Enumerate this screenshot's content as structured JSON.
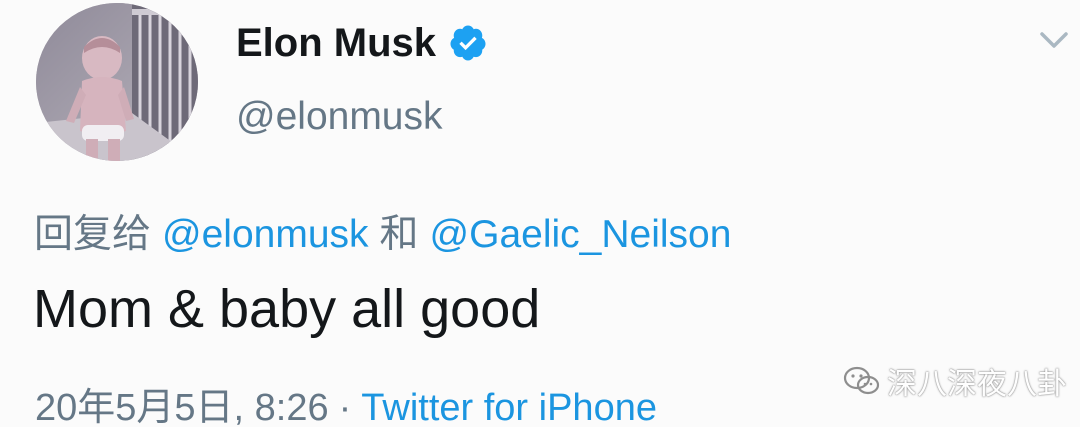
{
  "author": {
    "display_name": "Elon Musk",
    "handle": "@elonmusk",
    "verified": true,
    "avatar_icon": "toddler-photo-avatar"
  },
  "reply": {
    "prefix": "回复给",
    "mention_1": "@elonmusk",
    "conjunction": "和",
    "mention_2": "@Gaelic_Neilson"
  },
  "tweet": {
    "text": "Mom & baby all good"
  },
  "meta": {
    "timestamp": "20年5月5日, 8:26",
    "separator": "·",
    "source": "Twitter for iPhone"
  },
  "menu": {
    "icon": "chevron-down-icon"
  },
  "watermark": {
    "icon": "wechat-icon",
    "text": "深八深夜八卦"
  },
  "colors": {
    "text_primary": "#14171a",
    "text_secondary": "#657786",
    "link": "#1b95e0",
    "verified_badge": "#1da1f2"
  }
}
